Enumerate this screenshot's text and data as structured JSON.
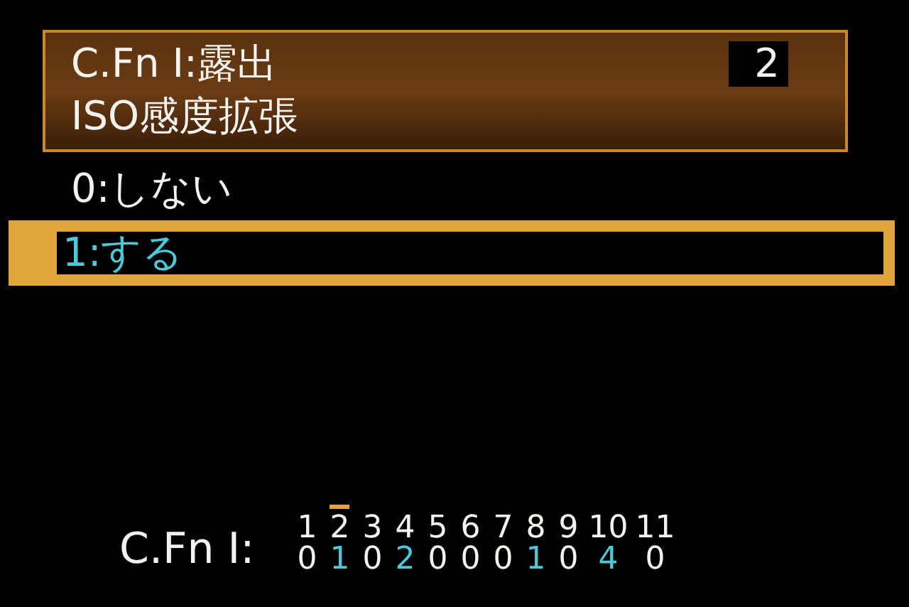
{
  "header": {
    "title": "C.Fn Ⅰ:露出",
    "number": "2",
    "subtitle": "ISO感度拡張"
  },
  "options": [
    {
      "label": "0:しない",
      "selected": false
    },
    {
      "label": "1:する",
      "selected": true
    }
  ],
  "footer": {
    "label": "C.Fn Ⅰ:",
    "functions": [
      {
        "number": "1",
        "value": "0",
        "selected": false,
        "changed": false
      },
      {
        "number": "2",
        "value": "1",
        "selected": true,
        "changed": true
      },
      {
        "number": "3",
        "value": "0",
        "selected": false,
        "changed": false
      },
      {
        "number": "4",
        "value": "2",
        "selected": false,
        "changed": true
      },
      {
        "number": "5",
        "value": "0",
        "selected": false,
        "changed": false
      },
      {
        "number": "6",
        "value": "0",
        "selected": false,
        "changed": false
      },
      {
        "number": "7",
        "value": "0",
        "selected": false,
        "changed": false
      },
      {
        "number": "8",
        "value": "1",
        "selected": false,
        "changed": true
      },
      {
        "number": "9",
        "value": "0",
        "selected": false,
        "changed": false
      },
      {
        "number": "10",
        "value": "4",
        "selected": false,
        "changed": true
      },
      {
        "number": "11",
        "value": "0",
        "selected": false,
        "changed": false
      }
    ]
  }
}
